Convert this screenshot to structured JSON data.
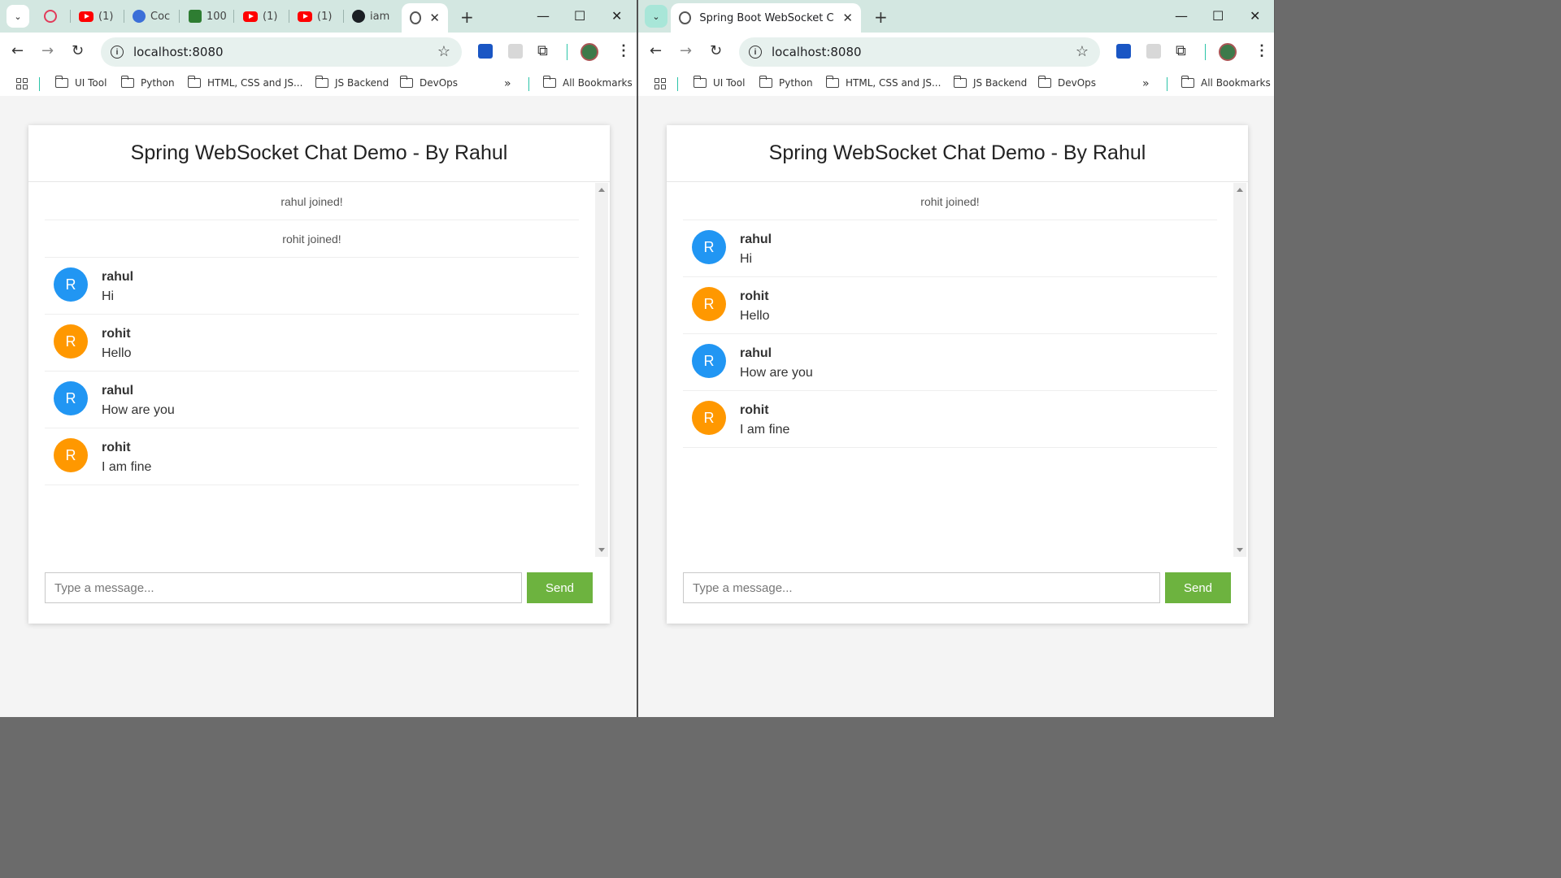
{
  "left": {
    "tabs": [
      {
        "icon": "pinterest-icon",
        "label": ""
      },
      {
        "icon": "youtube-icon",
        "label": "(1)"
      },
      {
        "icon": "copilot-icon",
        "label": "Coc"
      },
      {
        "icon": "app-icon",
        "label": "100"
      },
      {
        "icon": "youtube-icon",
        "label": "(1)"
      },
      {
        "icon": "youtube-icon",
        "label": "(1)"
      },
      {
        "icon": "github-icon",
        "label": "iam"
      }
    ],
    "active_tab": {
      "label": ""
    },
    "url": "localhost:8080",
    "events": [
      "rahul joined!",
      "rohit joined!"
    ],
    "messages": [
      {
        "initial": "R",
        "sender": "rahul",
        "text": "Hi",
        "color": "#2196f3"
      },
      {
        "initial": "R",
        "sender": "rohit",
        "text": "Hello",
        "color": "#ff9800"
      },
      {
        "initial": "R",
        "sender": "rahul",
        "text": "How are you",
        "color": "#2196f3"
      },
      {
        "initial": "R",
        "sender": "rohit",
        "text": "I am fine",
        "color": "#ff9800"
      }
    ]
  },
  "right": {
    "active_tab": {
      "label": "Spring Boot WebSocket Chat Ap"
    },
    "url": "localhost:8080",
    "events": [
      "rohit joined!"
    ],
    "messages": [
      {
        "initial": "R",
        "sender": "rahul",
        "text": "Hi",
        "color": "#2196f3"
      },
      {
        "initial": "R",
        "sender": "rohit",
        "text": "Hello",
        "color": "#ff9800"
      },
      {
        "initial": "R",
        "sender": "rahul",
        "text": "How are you",
        "color": "#2196f3"
      },
      {
        "initial": "R",
        "sender": "rohit",
        "text": "I am fine",
        "color": "#ff9800"
      }
    ]
  },
  "bookmarks": [
    "UI Tool",
    "Python",
    "HTML, CSS and JS...",
    "JS Backend",
    "DevOps",
    "All Bookmarks"
  ],
  "chat": {
    "title": "Spring WebSocket Chat Demo - By Rahul",
    "placeholder": "Type a message...",
    "send_label": "Send"
  },
  "colors": {
    "send_button": "#6db33f",
    "tab_strip": "#d3e7e1"
  }
}
